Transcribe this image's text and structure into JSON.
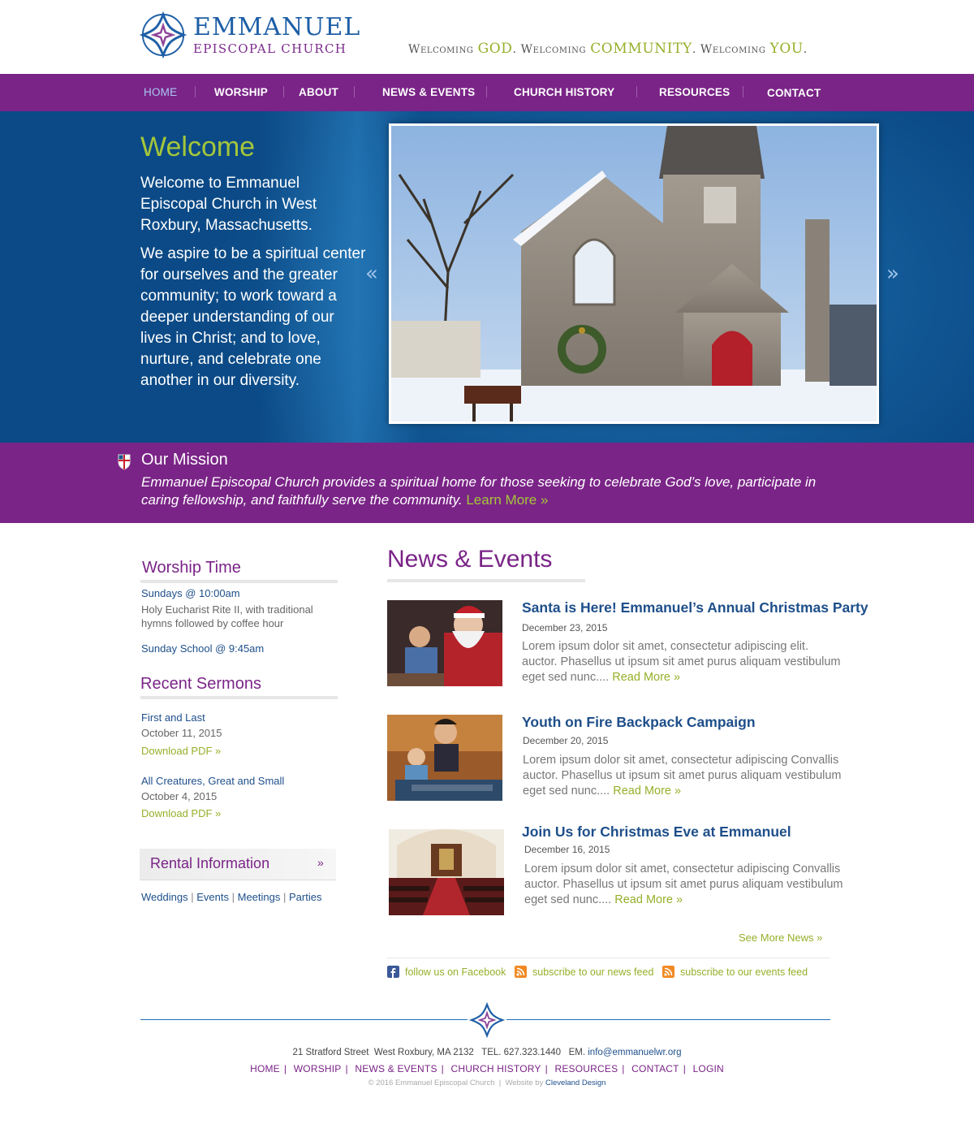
{
  "brand": {
    "name": "Emmanuel",
    "sub": "Episcopal Church",
    "tagline": [
      {
        "text": "Welcoming ",
        "hl": false
      },
      {
        "text": "GOD",
        "hl": true
      },
      {
        "text": ". Welcoming ",
        "hl": false
      },
      {
        "text": "COMMUNITY",
        "hl": true
      },
      {
        "text": ". Welcoming ",
        "hl": false
      },
      {
        "text": "YOU",
        "hl": true
      },
      {
        "text": ".",
        "hl": false
      }
    ]
  },
  "nav": {
    "items": [
      {
        "label": "HOME",
        "active": true
      },
      {
        "label": "WORSHIP"
      },
      {
        "label": "ABOUT"
      },
      {
        "label": "NEWS & EVENTS"
      },
      {
        "label": "CHURCH HISTORY"
      },
      {
        "label": "RESOURCES"
      },
      {
        "label": "CONTACT"
      }
    ]
  },
  "hero": {
    "title": "Welcome",
    "p1": "Welcome to Emmanuel Episcopal Church in West Roxbury, Massachusetts.",
    "p2": "We aspire to be a spiritual center for ourselves and the greater community; to work toward a deeper understanding of our lives in Christ; and to love, nurture, and celebrate one another in our diversity.",
    "prev": "«",
    "next": "»"
  },
  "mission": {
    "title": "Our Mission",
    "text": "Emmanuel Episcopal Church provides a spiritual home for those seeking to celebrate God’s love, participate in caring fellowship, and faithfully serve the community.",
    "link": "Learn More »"
  },
  "worship": {
    "heading": "Worship Time",
    "service1": "Sundays @ 10:00am",
    "service1_desc": "Holy Eucharist Rite II, with traditional hymns followed by coffee hour",
    "service2": "Sunday School @ 9:45am"
  },
  "sermons": {
    "heading": "Recent Sermons",
    "items": [
      {
        "title": "First and Last",
        "date": "October 11, 2015",
        "link": "Download PDF »"
      },
      {
        "title": "All Creatures, Great and Small",
        "date": "October 4, 2015",
        "link": "Download PDF »"
      }
    ]
  },
  "rental": {
    "label": "Rental Information",
    "chev": "»",
    "links": [
      "Weddings",
      "Events",
      "Meetings",
      "Parties"
    ],
    "sep": "|"
  },
  "news": {
    "heading": "News & Events",
    "items": [
      {
        "title": "Santa is Here! Emmanuel’s Annual Christmas Party",
        "date": "December 23, 2015",
        "body": "Lorem ipsum dolor sit amet, consectetur adipiscing elit. auctor. Phasellus ut ipsum sit amet purus aliquam vestibulum eget sed nunc.... ",
        "more": "Read More »"
      },
      {
        "title": "Youth on Fire Backpack Campaign",
        "date": "December 20, 2015",
        "body": "Lorem ipsum dolor sit amet, consectetur adipiscing Convallis auctor. Phasellus ut ipsum sit amet purus aliquam vestibulum eget sed nunc.... ",
        "more": "Read More »"
      },
      {
        "title": "Join Us for Christmas Eve at Emmanuel",
        "date": "December 16, 2015",
        "body": "Lorem ipsum dolor sit amet, consectetur adipiscing Convallis auctor. Phasellus ut ipsum sit amet purus aliquam vestibulum eget sed nunc.... ",
        "more": "Read More »"
      }
    ],
    "see_more": "See More News »"
  },
  "social": {
    "facebook": "follow us on Facebook",
    "news_feed": "subscribe to our news feed",
    "events_feed": "subscribe to our events feed"
  },
  "footer": {
    "address": "21 Stratford Street  West Roxbury, MA 2132   TEL. 627.323.1440   EM. ",
    "email": "info@emmanuelwr.org",
    "nav": [
      "HOME",
      "WORSHIP",
      "NEWS & EVENTS",
      "CHURCH HISTORY",
      "RESOURCES",
      "CONTACT",
      "LOGIN"
    ],
    "nav_sep": "|",
    "copyright": "© 2016 Emmanuel Episcopal Church  |  Website by ",
    "credit": "Cleveland Design"
  },
  "colors": {
    "purple": "#7a2487",
    "blue": "#1e4f8a",
    "green": "#95b02a",
    "hero_blue": "#15609e"
  }
}
